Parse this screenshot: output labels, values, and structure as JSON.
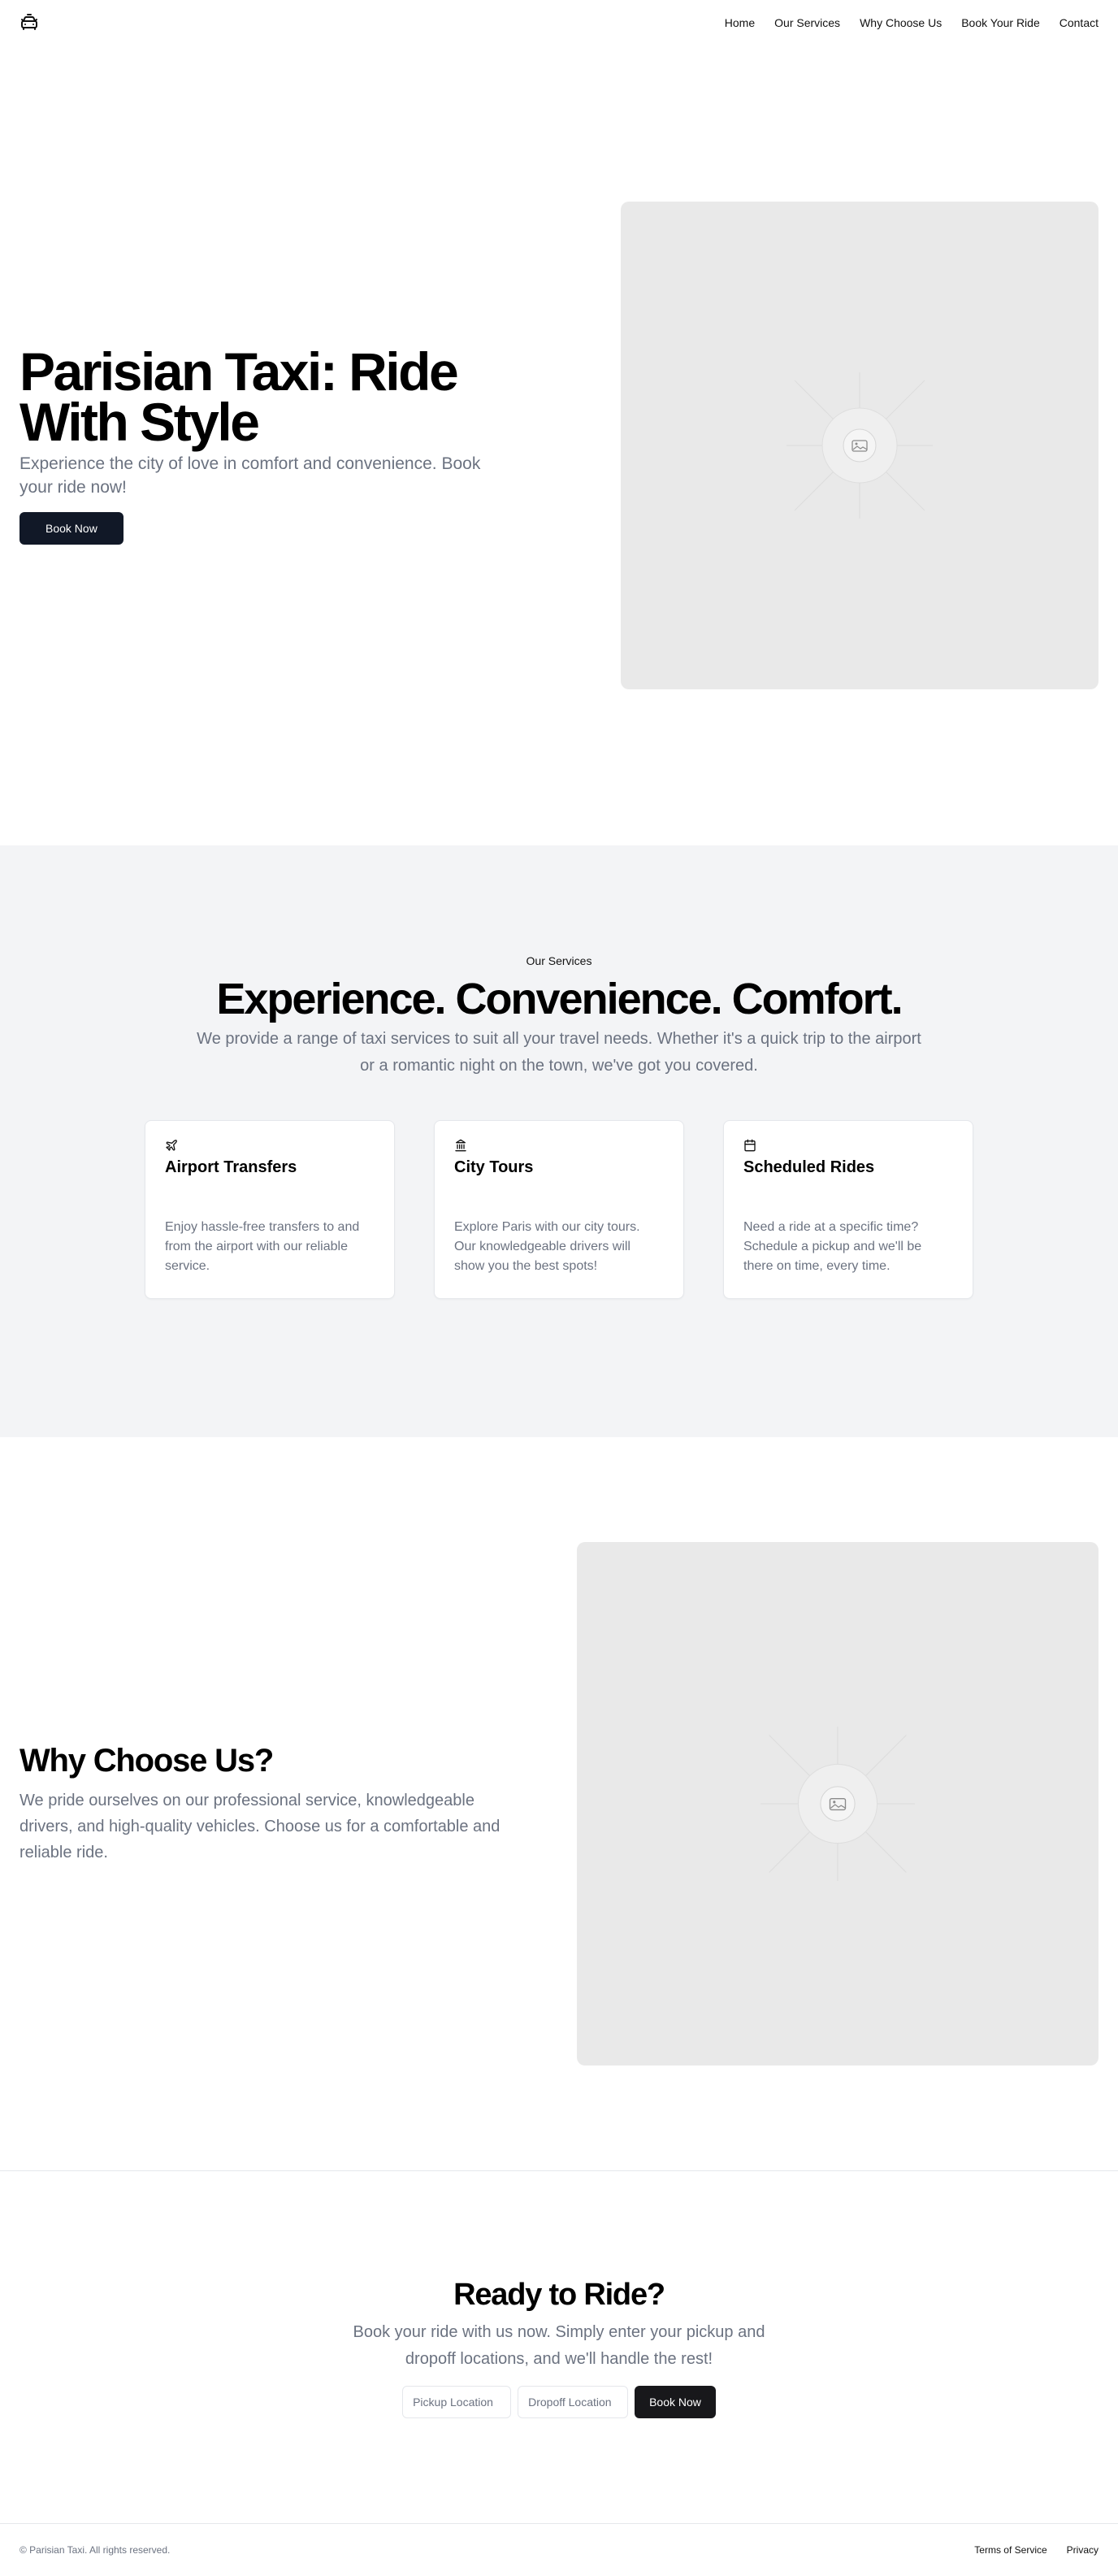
{
  "header": {
    "logo_icon": "taxi-car-icon",
    "nav": [
      {
        "label": "Home"
      },
      {
        "label": "Our Services"
      },
      {
        "label": "Why Choose Us"
      },
      {
        "label": "Book Your Ride"
      },
      {
        "label": "Contact"
      }
    ]
  },
  "hero": {
    "title": "Parisian Taxi: Ride With Style",
    "subtitle": "Experience the city of love in comfort and convenience. Book your ride now!",
    "button_label": "Book Now",
    "image_icon": "image-placeholder-icon"
  },
  "services": {
    "eyebrow": "Our Services",
    "title": "Experience. Convenience. Comfort.",
    "subtitle": "We provide a range of taxi services to suit all your travel needs. Whether it's a quick trip to the airport or a romantic night on the town, we've got you covered.",
    "cards": [
      {
        "icon": "plane-icon",
        "title": "Airport Transfers",
        "text": "Enjoy hassle-free transfers to and from the airport with our reliable service."
      },
      {
        "icon": "landmark-icon",
        "title": "City Tours",
        "text": "Explore Paris with our city tours. Our knowledgeable drivers will show you the best spots!"
      },
      {
        "icon": "calendar-icon",
        "title": "Scheduled Rides",
        "text": "Need a ride at a specific time? Schedule a pickup and we'll be there on time, every time."
      }
    ]
  },
  "why": {
    "title": "Why Choose Us?",
    "text": "We pride ourselves on our professional service, knowledgeable drivers, and high-quality vehicles. Choose us for a comfortable and reliable ride.",
    "image_icon": "image-placeholder-icon"
  },
  "cta": {
    "title": "Ready to Ride?",
    "subtitle": "Book your ride with us now. Simply enter your pickup and dropoff locations, and we'll handle the rest!",
    "pickup_placeholder": "Pickup Location",
    "dropoff_placeholder": "Dropoff Location",
    "button_label": "Book Now"
  },
  "footer": {
    "copyright": "© Parisian Taxi. All rights reserved.",
    "links": [
      {
        "label": "Terms of Service"
      },
      {
        "label": "Privacy"
      }
    ]
  }
}
